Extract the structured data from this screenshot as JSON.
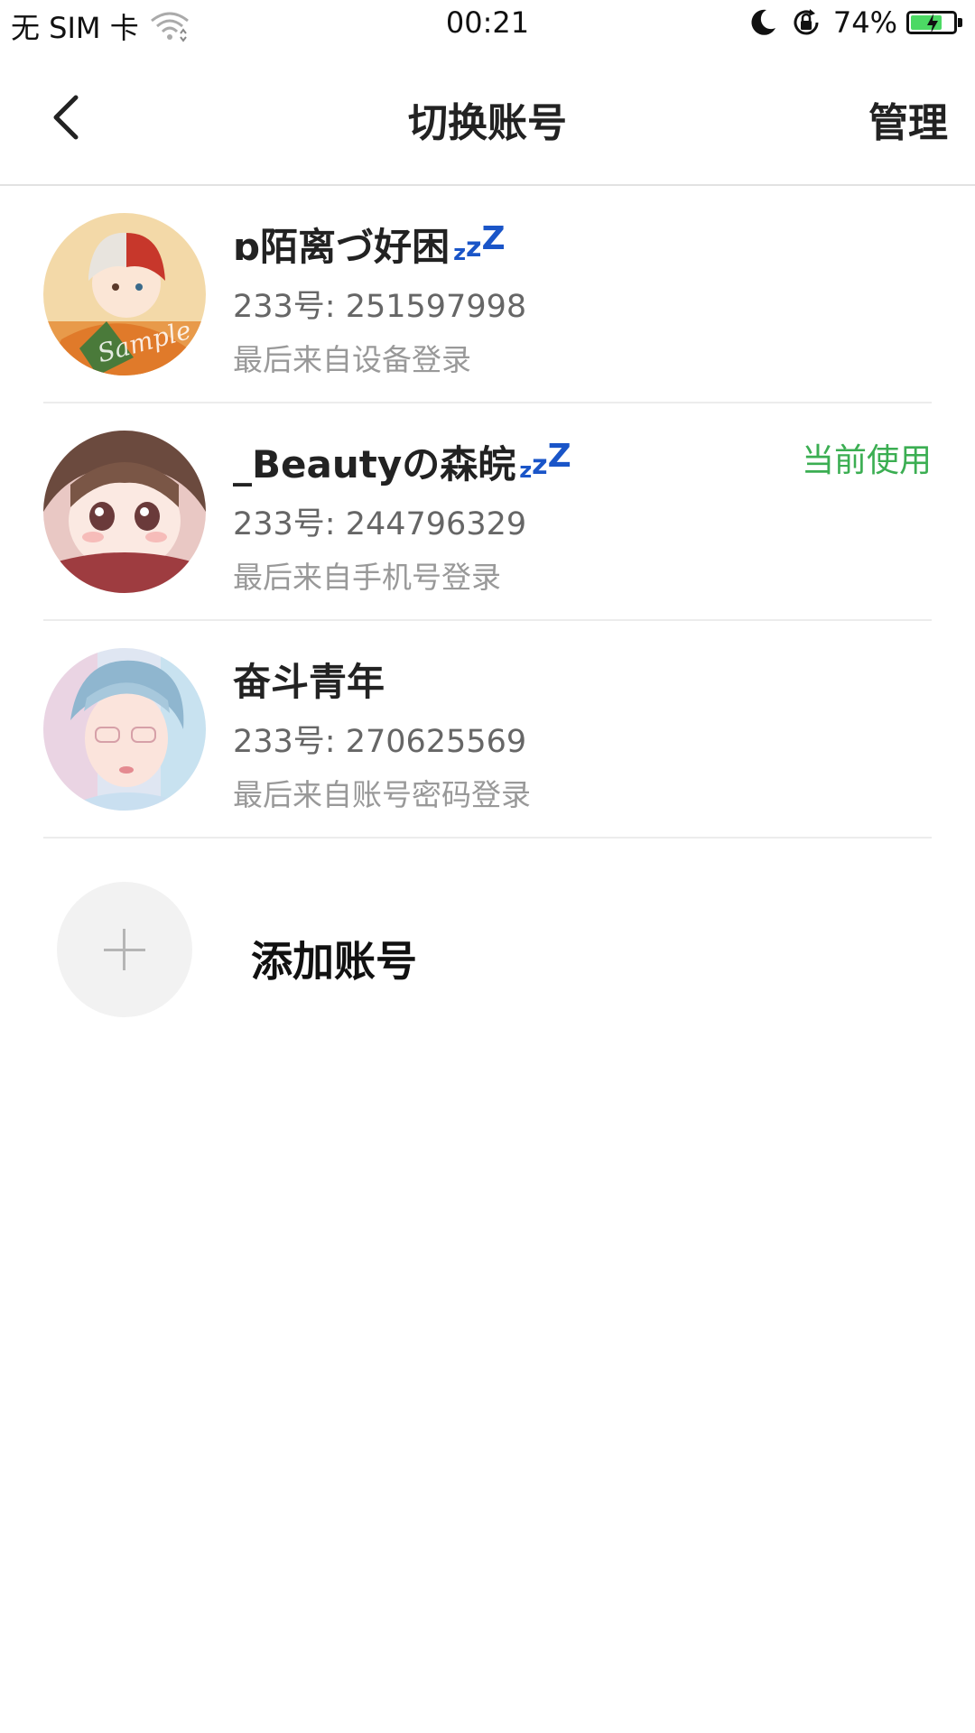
{
  "status_bar": {
    "carrier": "无 SIM 卡",
    "time": "00:21",
    "battery_pct": "74%",
    "battery_level": 0.74,
    "icons": [
      "wifi-icon",
      "moon-icon",
      "rotation-lock-icon",
      "battery-charging-icon"
    ]
  },
  "nav": {
    "title": "切换账号",
    "manage": "管理",
    "back_icon": "chevron-left-icon"
  },
  "accounts": [
    {
      "name": "ɒ陌离づ好困",
      "zzz": [
        "z",
        "z",
        "Z"
      ],
      "id": "233号: 251597998",
      "login": "最后来自设备登录",
      "badge": "",
      "avatar": "avatar-red-white-hair"
    },
    {
      "name": "_Beautyの森皖",
      "zzz": [
        "z",
        "z",
        "Z"
      ],
      "id": "233号: 244796329",
      "login": "最后来自手机号登录",
      "badge": "当前使用",
      "avatar": "avatar-brown-hair-girl"
    },
    {
      "name": "奋斗青年",
      "zzz": [],
      "id": "233号: 270625569",
      "login": "最后来自账号密码登录",
      "badge": "",
      "avatar": "avatar-blue-hair-boy"
    }
  ],
  "add_account": {
    "label": "添加账号",
    "icon": "plus-icon"
  },
  "colors": {
    "current_badge": "#3bae52",
    "zzz": "#1a55c8",
    "divider": "#ececec",
    "add_circle_bg": "#f2f2f2"
  }
}
